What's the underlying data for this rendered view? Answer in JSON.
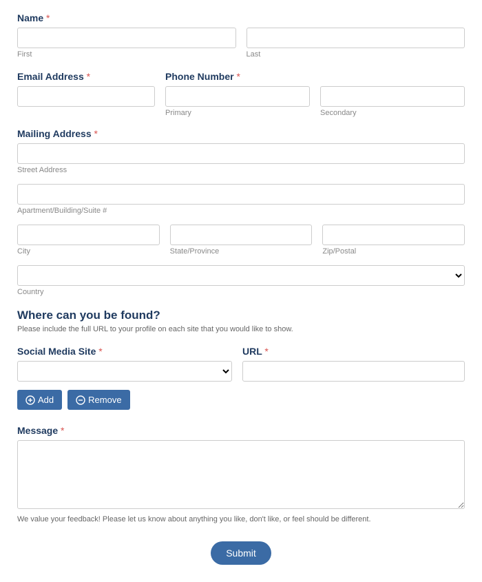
{
  "name": {
    "label": "Name",
    "required": "*",
    "first_sub": "First",
    "last_sub": "Last"
  },
  "email": {
    "label": "Email Address",
    "required": "*"
  },
  "phone": {
    "label": "Phone Number",
    "required": "*",
    "primary_sub": "Primary",
    "secondary_sub": "Secondary"
  },
  "mailing": {
    "label": "Mailing Address",
    "required": "*",
    "street_sub": "Street Address",
    "apt_sub": "Apartment/Building/Suite #",
    "city_sub": "City",
    "state_sub": "State/Province",
    "zip_sub": "Zip/Postal",
    "country_sub": "Country"
  },
  "whereFound": {
    "title": "Where can you be found?",
    "desc": "Please include the full URL to your profile on each site that you would like to show."
  },
  "social": {
    "label": "Social Media Site",
    "required": "*"
  },
  "url": {
    "label": "URL",
    "required": "*"
  },
  "buttons": {
    "add": "Add",
    "remove": "Remove",
    "submit": "Submit"
  },
  "message": {
    "label": "Message",
    "required": "*",
    "help": "We value your feedback! Please let us know about anything you like, don't like, or feel should be different."
  }
}
